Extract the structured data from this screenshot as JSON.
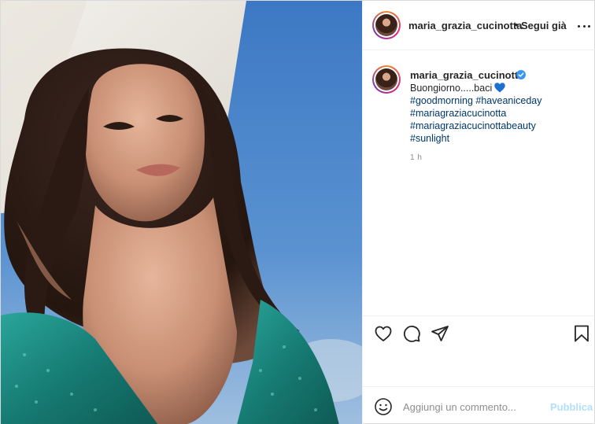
{
  "post": {
    "username": "maria_grazia_cucinotta",
    "separator": "•",
    "follow_state": "Segui già",
    "caption_text": "Buongiorno.....baci",
    "caption_emoji": "blue-heart-icon",
    "hashtags": [
      "#goodmorning #haveaniceday",
      "#mariagraziacucinotta",
      "#mariagraziacucinottabeauty",
      "#sunlight"
    ],
    "timestamp": "1 h",
    "verified": true
  },
  "comment": {
    "placeholder": "Aggiungi un commento...",
    "publish_label": "Pubblica"
  },
  "icons": {
    "like": "heart-outline-icon",
    "comment": "comment-bubble-icon",
    "share": "paper-plane-icon",
    "save": "bookmark-icon",
    "emoji": "smiley-icon",
    "more": "more-options-icon"
  },
  "colors": {
    "link": "#00376b",
    "verified": "#3897f0",
    "publish_disabled": "#b2dffc",
    "muted": "#8e8e8e",
    "sky": "#3f7bc6",
    "dress": "#1e8f86"
  }
}
